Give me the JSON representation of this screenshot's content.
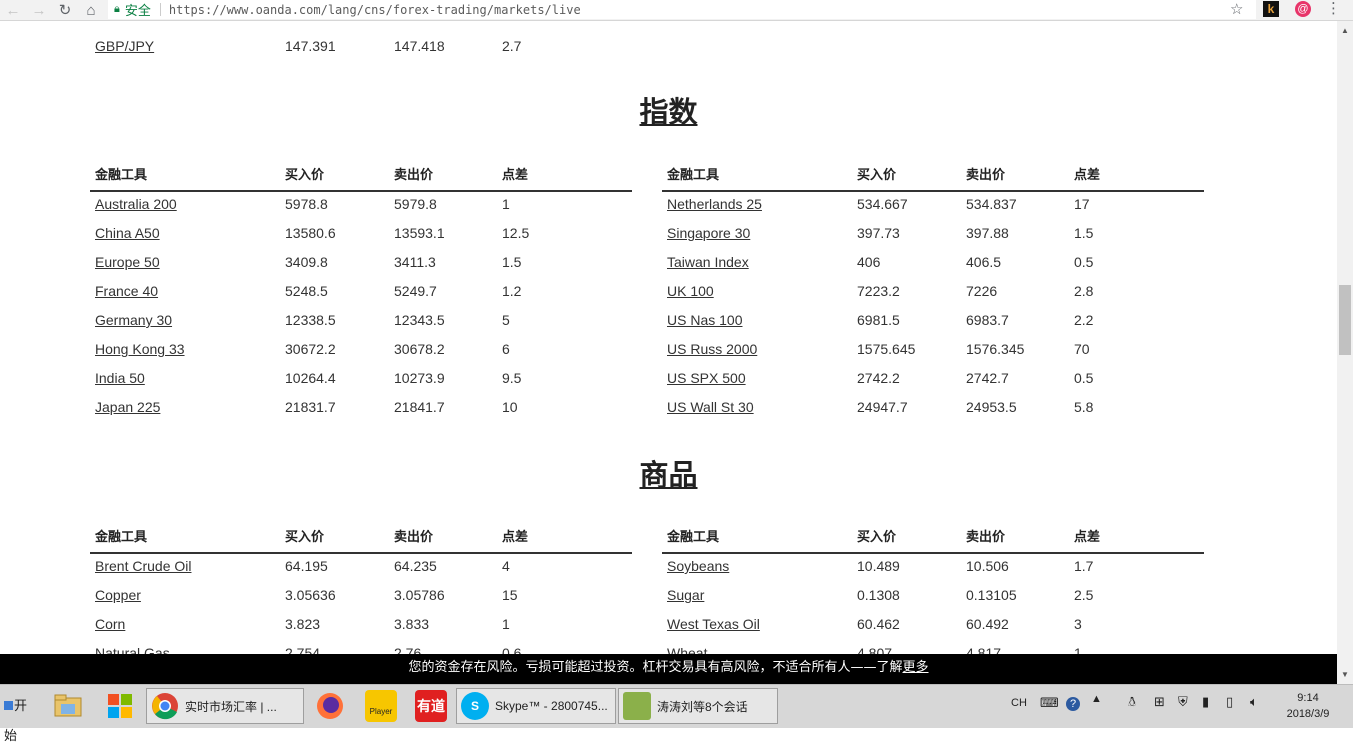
{
  "browser": {
    "secure_label": "安全",
    "url": "https://www.oanda.com/lang/cns/forex-trading/markets/live"
  },
  "top_row": {
    "name": "GBP/JPY",
    "bid": "147.391",
    "ask": "147.418",
    "spread": "2.7"
  },
  "sections": [
    {
      "title": "指数",
      "headers": [
        "金融工具",
        "买入价",
        "卖出价",
        "点差"
      ],
      "left": [
        [
          "Australia 200",
          "5978.8",
          "5979.8",
          "1"
        ],
        [
          "China A50",
          "13580.6",
          "13593.1",
          "12.5"
        ],
        [
          "Europe 50",
          "3409.8",
          "3411.3",
          "1.5"
        ],
        [
          "France 40",
          "5248.5",
          "5249.7",
          "1.2"
        ],
        [
          "Germany 30",
          "12338.5",
          "12343.5",
          "5"
        ],
        [
          "Hong Kong 33",
          "30672.2",
          "30678.2",
          "6"
        ],
        [
          "India 50",
          "10264.4",
          "10273.9",
          "9.5"
        ],
        [
          "Japan 225",
          "21831.7",
          "21841.7",
          "10"
        ]
      ],
      "right": [
        [
          "Netherlands 25",
          "534.667",
          "534.837",
          "17"
        ],
        [
          "Singapore 30",
          "397.73",
          "397.88",
          "1.5"
        ],
        [
          "Taiwan Index",
          "406",
          "406.5",
          "0.5"
        ],
        [
          "UK 100",
          "7223.2",
          "7226",
          "2.8"
        ],
        [
          "US Nas 100",
          "6981.5",
          "6983.7",
          "2.2"
        ],
        [
          "US Russ 2000",
          "1575.645",
          "1576.345",
          "70"
        ],
        [
          "US SPX 500",
          "2742.2",
          "2742.7",
          "0.5"
        ],
        [
          "US Wall St 30",
          "24947.7",
          "24953.5",
          "5.8"
        ]
      ]
    },
    {
      "title": "商品",
      "headers": [
        "金融工具",
        "买入价",
        "卖出价",
        "点差"
      ],
      "left": [
        [
          "Brent Crude Oil",
          "64.195",
          "64.235",
          "4"
        ],
        [
          "Copper",
          "3.05636",
          "3.05786",
          "15"
        ],
        [
          "Corn",
          "3.823",
          "3.833",
          "1"
        ],
        [
          "Natural Gas",
          "2.754",
          "2.76",
          "0.6"
        ]
      ],
      "right": [
        [
          "Soybeans",
          "10.489",
          "10.506",
          "1.7"
        ],
        [
          "Sugar",
          "0.1308",
          "0.13105",
          "2.5"
        ],
        [
          "West Texas Oil",
          "60.462",
          "60.492",
          "3"
        ],
        [
          "Wheat",
          "4.807",
          "4.817",
          "1"
        ]
      ]
    }
  ],
  "banner": {
    "text": "您的资金存在风险。亏损可能超过投资。杠杆交易具有高风险，不适合所有人——了解",
    "link": "更多"
  },
  "taskbar": {
    "start_label": "开始",
    "buttons": [
      {
        "label": "实时市场汇率 | ...",
        "icon": "chrome-icon"
      },
      {
        "label": "Skype™ - 2800745...",
        "icon": "skype-icon"
      },
      {
        "label": "涛涛刘等8个会话",
        "icon": "qq-chat-icon"
      }
    ],
    "quick_launch": [
      "explorer-icon",
      "windows-store-icon",
      "firefox-icon",
      "player-icon",
      "youdao-icon"
    ],
    "player_label": "Player",
    "youdao_label": "有道",
    "ime": "CH",
    "time": "9:14",
    "date": "2018/3/9"
  }
}
